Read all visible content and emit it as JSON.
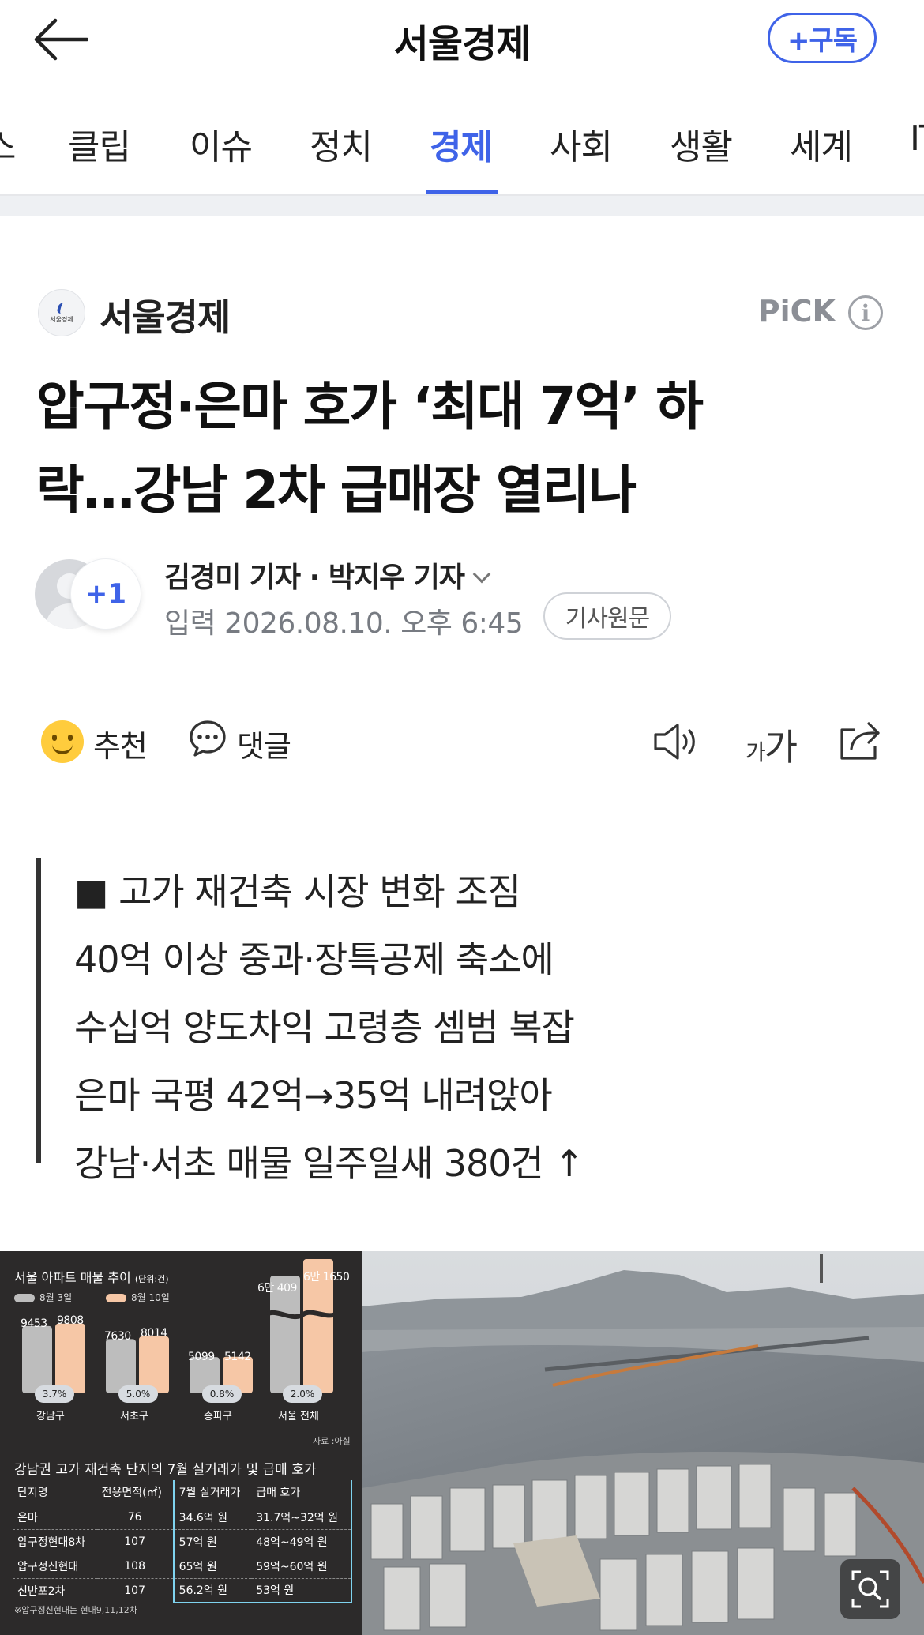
{
  "header": {
    "title": "서울경제",
    "subscribe_label": "+구독"
  },
  "tabs": [
    {
      "label": "스",
      "active": false
    },
    {
      "label": "클립",
      "active": false
    },
    {
      "label": "이슈",
      "active": false
    },
    {
      "label": "정치",
      "active": false
    },
    {
      "label": "경제",
      "active": true
    },
    {
      "label": "사회",
      "active": false
    },
    {
      "label": "생활",
      "active": false
    },
    {
      "label": "세계",
      "active": false
    },
    {
      "label": "IT",
      "active": false
    }
  ],
  "article": {
    "press_name": "서울경제",
    "press_logo_text": "서울경제",
    "pick_label": "PiCK",
    "headline_line1": "압구정·은마 호가 ‘최대 7억’ 하",
    "headline_line2": "락…강남 2차 급매장 열리나",
    "extra_reporters_badge": "+1",
    "reporters": "김경미 기자 · 박지우 기자",
    "date": "입력 2026.08.10. 오후 6:45",
    "original_link_label": "기사원문"
  },
  "actions": {
    "recommend_label": "추천",
    "comment_label": "댓글",
    "font_size_small": "가",
    "font_size_large": "가"
  },
  "summary": [
    "■ 고가 재건축 시장 변화 조짐",
    "40억 이상 중과·장특공제 축소에",
    "수십억 양도차익 고령층 셈범 복잡",
    "은마 국평 42억→35억 내려앉아",
    "강남·서초 매물 일주일새 380건 ↑"
  ],
  "infographic": {
    "chart_title": "서울 아파트 매물 추이",
    "chart_unit": "(단위:건)",
    "legend_a": "8월 3일",
    "legend_b": "8월 10일",
    "colors": {
      "before": "#bdbdbd",
      "after": "#f6c7a6"
    },
    "source": "자료 :아실",
    "chart_data": {
      "type": "bar",
      "categories": [
        "강남구",
        "서초구",
        "송파구",
        "서울 전체"
      ],
      "series": [
        {
          "name": "8월 3일",
          "values": [
            9453,
            7630,
            5099,
            60409
          ]
        },
        {
          "name": "8월 10일",
          "values": [
            9808,
            8014,
            5142,
            61650
          ]
        }
      ],
      "value_labels_before": [
        "9453",
        "7630",
        "5099",
        "6만 409"
      ],
      "value_labels_after": [
        "9808",
        "8014",
        "5142",
        "6만 1650"
      ],
      "change_labels": [
        "3.7%",
        "5.0%",
        "0.8%",
        "2.0%"
      ]
    },
    "table_title": "강남권 고가 재건축 단지의 7월 실거래가 및 급매 호가",
    "table_headers": [
      "단지명",
      "전용면적(㎡)",
      "7월 실거래가",
      "급매 호가"
    ],
    "table_rows": [
      [
        "은마",
        "76",
        "34.6억 원",
        "31.7억~32억 원"
      ],
      [
        "압구정현대8차",
        "107",
        "57억 원",
        "48억~49억 원"
      ],
      [
        "압구정신현대",
        "108",
        "65억 원",
        "59억~60억 원"
      ],
      [
        "신반포2차",
        "107",
        "56.2억 원",
        "53억 원"
      ]
    ],
    "footnote": "※압구정신현대는 현대9,11,12차"
  }
}
